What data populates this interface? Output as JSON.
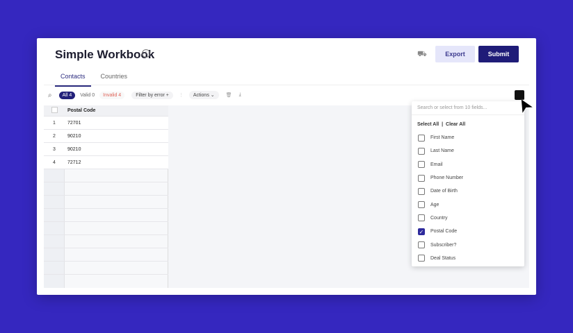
{
  "header": {
    "title": "Simple Workbook",
    "export_label": "Export",
    "submit_label": "Submit"
  },
  "tabs": [
    {
      "label": "Contacts",
      "active": true
    },
    {
      "label": "Countries",
      "active": false
    }
  ],
  "toolbar": {
    "all": "All 4",
    "valid": "Valid 0",
    "invalid": "Invalid 4",
    "filter": "Filter by error",
    "actions": "Actions"
  },
  "table": {
    "header": "Postal Code",
    "rows": [
      {
        "n": "1",
        "v": "72701"
      },
      {
        "n": "2",
        "v": "90210"
      },
      {
        "n": "3",
        "v": "90210"
      },
      {
        "n": "4",
        "v": "72712"
      }
    ]
  },
  "fields_menu": {
    "placeholder": "Search or select from 10 fields...",
    "select_all": "Select All",
    "clear_all": "Clear All",
    "options": [
      {
        "label": "First Name",
        "checked": false
      },
      {
        "label": "Last Name",
        "checked": false
      },
      {
        "label": "Email",
        "checked": false
      },
      {
        "label": "Phone Number",
        "checked": false
      },
      {
        "label": "Date of Birth",
        "checked": false
      },
      {
        "label": "Age",
        "checked": false
      },
      {
        "label": "Country",
        "checked": false
      },
      {
        "label": "Postal Code",
        "checked": true
      },
      {
        "label": "Subscriber?",
        "checked": false
      },
      {
        "label": "Deal Status",
        "checked": false
      }
    ]
  },
  "colors": {
    "background": "#3527bf",
    "primary": "#1f1c78",
    "invalid": "#e0655a"
  }
}
